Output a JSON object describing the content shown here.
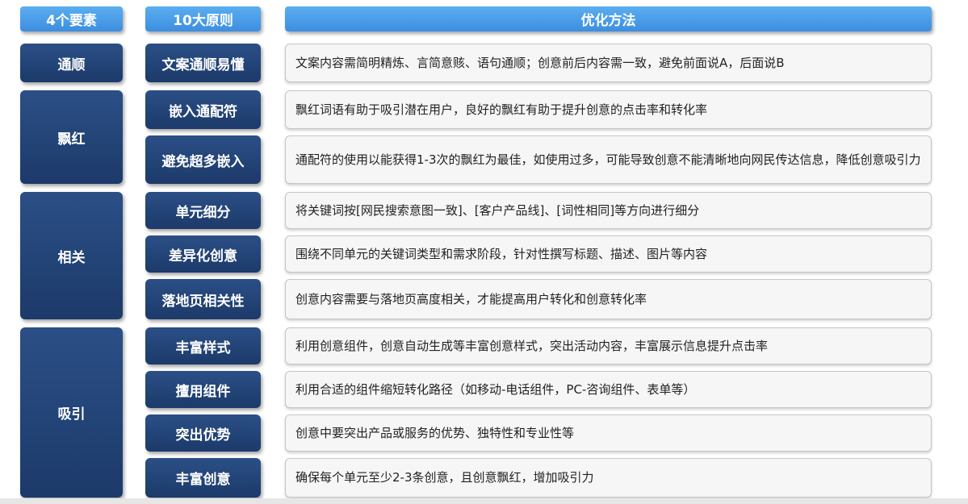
{
  "headers": {
    "elements": "4个要素",
    "principles": "10大原则",
    "methods": "优化方法"
  },
  "elements": [
    "通顺",
    "飘红",
    "相关",
    "吸引"
  ],
  "principles": [
    "文案通顺易懂",
    "嵌入通配符",
    "避免超多嵌入",
    "单元细分",
    "差异化创意",
    "落地页相关性",
    "丰富样式",
    "擅用组件",
    "突出优势",
    "丰富创意"
  ],
  "methods": [
    "文案内容需简明精炼、言简意赅、语句通顺；创意前后内容需一致，避免前面说A，后面说B",
    "飘红词语有助于吸引潜在用户，良好的飘红有助于提升创意的点击率和转化率",
    "通配符的使用以能获得1-3次的飘红为最佳，如使用过多，可能导致创意不能清晰地向网民传达信息，降低创意吸引力",
    "将关键词按[网民搜索意图一致]、[客户产品线]、[词性相同]等方向进行细分",
    "围绕不同单元的关键词类型和需求阶段，针对性撰写标题、描述、图片等内容",
    "创意内容需要与落地页高度相关，才能提高用户转化和创意转化率",
    "利用创意组件，创意自动生成等丰富创意样式，突出活动内容，丰富展示信息提升点击率",
    "利用合适的组件缩短转化路径（如移动-电话组件，PC-咨询组件、表单等）",
    "创意中要突出产品或服务的优势、独特性和专业性等",
    "确保每个单元至少2-3条创意，且创意飘红，增加吸引力"
  ]
}
